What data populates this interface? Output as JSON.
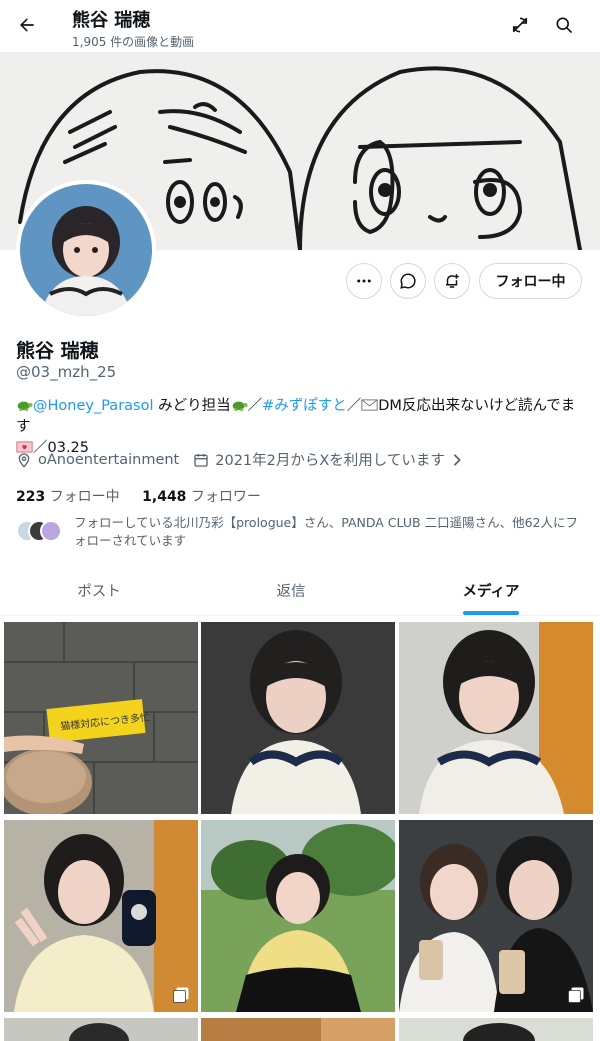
{
  "header": {
    "title": "熊谷 瑞穂",
    "subtitle": "1,905 件の画像と動画",
    "back_icon": "arrow-left-icon",
    "refresh_icon": "refresh-off-icon",
    "search_icon": "search-icon"
  },
  "actions": {
    "more_icon": "more-icon",
    "message_icon": "message-icon",
    "notify_icon": "notification-plus-icon",
    "follow_label": "フォロー中"
  },
  "profile": {
    "name": "熊谷 瑞穂",
    "handle": "@03_mzh_25",
    "bio": {
      "link1": "@Honey_Parasol",
      "text1": " みどり担当",
      "sep1": "／",
      "hashtag": "#みずぽすと",
      "sep2": "／",
      "text2": "DM反応出来ないけど読んでます",
      "text3": "／03.25"
    },
    "location": "oAnoentertainment",
    "joined": "2021年2月からXを利用しています",
    "following_count": "223",
    "following_label": "フォロー中",
    "followers_count": "1,448",
    "followers_label": "フォロワー",
    "followed_by": "フォローしている北川乃彩【prologue】さん、PANDA CLUB 二口遥陽さん、他62人にフォローされています"
  },
  "tabs": [
    {
      "label": "ポスト"
    },
    {
      "label": "返信"
    },
    {
      "label": "メディア"
    }
  ],
  "media": {
    "sign_text": "猫様対応につき多忙"
  },
  "colors": {
    "accent": "#1d9bf0",
    "text": "#0f1419",
    "muted": "#536471",
    "border": "#cfd9de"
  }
}
